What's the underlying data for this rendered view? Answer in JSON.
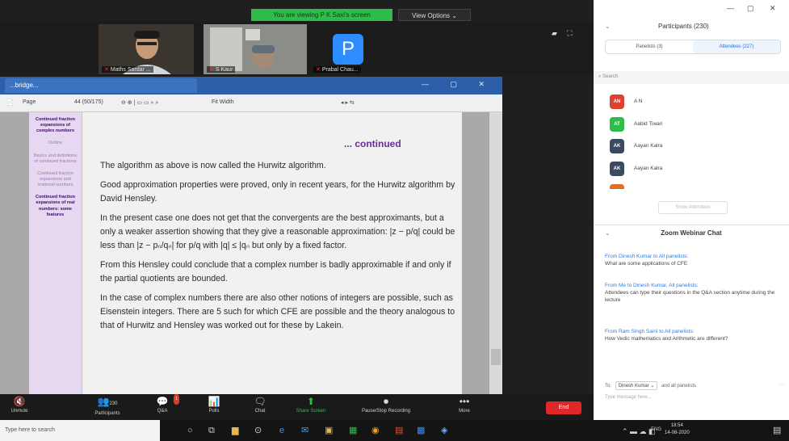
{
  "banner": {
    "text": "You are viewing P K Saxi's screen",
    "view_options": "View Options ⌄"
  },
  "videos": [
    {
      "name": "Maths Sardar ..."
    },
    {
      "name": "S Kaur"
    },
    {
      "name": "Prabal Chau...",
      "initial": "P"
    }
  ],
  "share_window": {
    "tab_title": "...bridge...",
    "toolbar": {
      "page_label": "Page",
      "page_value": "44 (50/175)",
      "zoom": "Fit Width",
      "nav": "◂  ▸  ⇆"
    }
  },
  "slide": {
    "sidebar": [
      {
        "text": "Continued fraction expansions of complex numbers",
        "style": "active"
      },
      {
        "text": "Outline",
        "style": "dim"
      },
      {
        "text": "Basics and definitions of continued fractions",
        "style": "dim"
      },
      {
        "text": "Continued fraction expansions and irrational numbers",
        "style": "dim"
      },
      {
        "text": "Continued fraction expansions of real numbers: some features",
        "style": "active"
      }
    ],
    "heading": "... continued",
    "paragraphs": [
      "The algorithm as above is now called the Hurwitz algorithm.",
      "Good approximation properties were proved, only in recent years, for the Hurwitz algorithm by David Hensley.",
      "In the present case one does not get that the convergents are the best approximants, but a only a weaker assertion showing that they give a reasonable approximation: |z − p/q| could be less than |z − pₙ/qₙ| for p/q with |q| ≤ |qₙ but only by a fixed factor.",
      "From this Hensley could conclude that a complex number is badly approximable if and only if the partial quotients are bounded.",
      "In the case of complex numbers there are also other notions of integers are possible, such as Eisenstein integers. There are 5 such for which CFE are possible and the theory analogous to that of Hurwitz and Hensley was worked out for these by Lakein."
    ]
  },
  "zoombar": {
    "items": [
      {
        "icon": "🔇",
        "label": "Unmute"
      },
      {
        "icon": "👥",
        "label": "Participants",
        "count": "230"
      },
      {
        "icon": "💬",
        "label": "Q&A",
        "badge": "1"
      },
      {
        "icon": "📊",
        "label": "Polls"
      },
      {
        "icon": "🗨",
        "label": "Chat"
      },
      {
        "icon": "⬆",
        "label": "Share Screen"
      },
      {
        "icon": "⏺",
        "label": "Pause/Stop Recording"
      },
      {
        "icon": "•••",
        "label": "More"
      }
    ],
    "end_label": "End"
  },
  "panel": {
    "titlebar": {
      "min": "—",
      "max": "▢",
      "close": "✕"
    },
    "header": "Participants (230)",
    "tabs": [
      "Panelists (3)",
      "Attendees (227)"
    ],
    "search_placeholder": "Search",
    "participants": [
      {
        "initials": "AN",
        "name": "A N",
        "color": "#e04030"
      },
      {
        "initials": "AT",
        "name": "Aabid Tiwari",
        "color": "#2ebd4a"
      },
      {
        "initials": "AK",
        "name": "Aayan Kalra",
        "color": "#3a4a60"
      },
      {
        "initials": "AK",
        "name": "Aayan Kalra",
        "color": "#3a4a60"
      }
    ],
    "show_attendees": "Show Attendees",
    "chat_title": "Zoom Webinar Chat",
    "messages": [
      {
        "from": "From Dinesh Kumar to All panelists:",
        "text": "What are some applications of CFE"
      },
      {
        "from": "From Me to Dinesh Kumar, All panelists:",
        "text": "Attendees can type their questions in the Q&A section anytime during the lecture"
      },
      {
        "from": "From Ram Singh Saini to All panelists:",
        "text": "How Vedic mathematics and Arithmetic are different?"
      }
    ],
    "to_label": "To:",
    "to_value": "Dinesh Kumar ⌄",
    "to_suffix": "and all panelists",
    "type_placeholder": "Type message here..."
  },
  "taskbar": {
    "search": "Type here to search",
    "time": "18:54",
    "date": "14-08-2020",
    "lang": "ENG"
  },
  "colors": {
    "accent": "#2d8cff",
    "share_green": "#2ebd4a",
    "end_red": "#e02828",
    "slide_purple": "#6a2aa0"
  }
}
